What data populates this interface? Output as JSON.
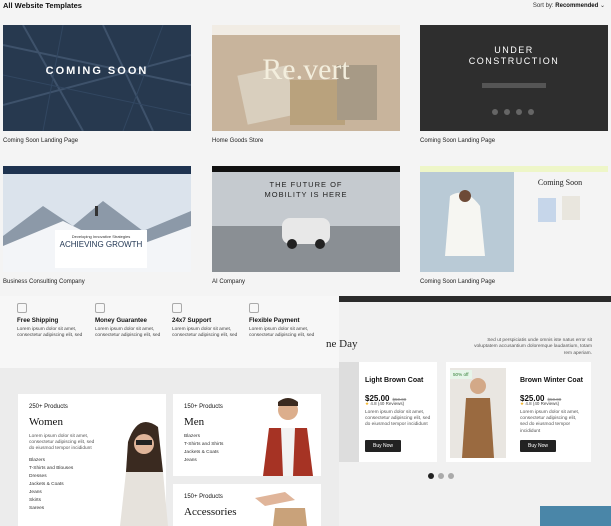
{
  "header": {
    "title": "All Website Templates",
    "sort_label": "Sort by:",
    "sort_value": "Recommended"
  },
  "templates": [
    {
      "name": "Coming Soon Landing Page",
      "hero": "COMING SOON"
    },
    {
      "name": "Home Goods Store",
      "hero": "Re.vert"
    },
    {
      "name": "Coming Soon Landing Page",
      "hero": "UNDER CONSTRUCTION"
    },
    {
      "name": "Business Consulting Company",
      "hero": "ACHIEVING GROWTH",
      "sub": "Developing Innovative Strategies"
    },
    {
      "name": "AI Company",
      "hero": "THE FUTURE OF MOBILITY IS HERE"
    },
    {
      "name": "Coming Soon Landing Page",
      "hero": "Coming Soon"
    }
  ],
  "features": [
    {
      "title": "Free Shipping",
      "desc": "Lorem ipsum dolor sit amet, consectetur adipiscing elit, sed"
    },
    {
      "title": "Money Guarantee",
      "desc": "Lorem ipsum dolor sit amet, consectetur adipiscing elit, sed"
    },
    {
      "title": "24x7 Support",
      "desc": "Lorem ipsum dolor sit amet, consectetur adipiscing elit, sed"
    },
    {
      "title": "Flexible Payment",
      "desc": "Lorem ipsum dolor sit amet, consectetur adipiscing elit, sed"
    }
  ],
  "categories": [
    {
      "count": "250+ Products",
      "title": "Women",
      "desc": "Lorem ipsum dolor sit amet, consectetur adipiscing elit, sed do eiusmod tempor incididunt",
      "items": [
        "Blazers",
        "T-Shirts and Blouses",
        "Dresses",
        "Jackets & Coats",
        "Jeans",
        "Skirts",
        "Sarees"
      ]
    },
    {
      "count": "150+ Products",
      "title": "Men",
      "items": [
        "Blazers",
        "T-Shirts and Shirts",
        "Jackets & Coats",
        "Jeans"
      ]
    },
    {
      "count": "150+ Products",
      "title": "Accessories"
    }
  ],
  "deals": {
    "title_fragment": "ne Day",
    "desc": "Sed ut perspiciatis unde omnis iste natus error sit voluptatem accusantium doloremque laudantium, totam rem aperiam."
  },
  "products": [
    {
      "name": "Light Brown Coat",
      "price": "$25.00",
      "old": "$50.00",
      "rating": "4.8 (40 Reviews)",
      "desc": "Lorem ipsum dolor sit amet, consectetur adipiscing elit, sed do eiusmod tempor incididunt",
      "button": "Buy Now"
    },
    {
      "name": "Brown Winter Coat",
      "price": "$25.00",
      "old": "$50.00",
      "rating": "4.8 (40 Reviews)",
      "desc": "Lorem ipsum dolor sit amet, consectetur adipiscing elit, sed do eiusmod tempor incididunt",
      "button": "Buy Now",
      "badge": "50% off"
    }
  ]
}
